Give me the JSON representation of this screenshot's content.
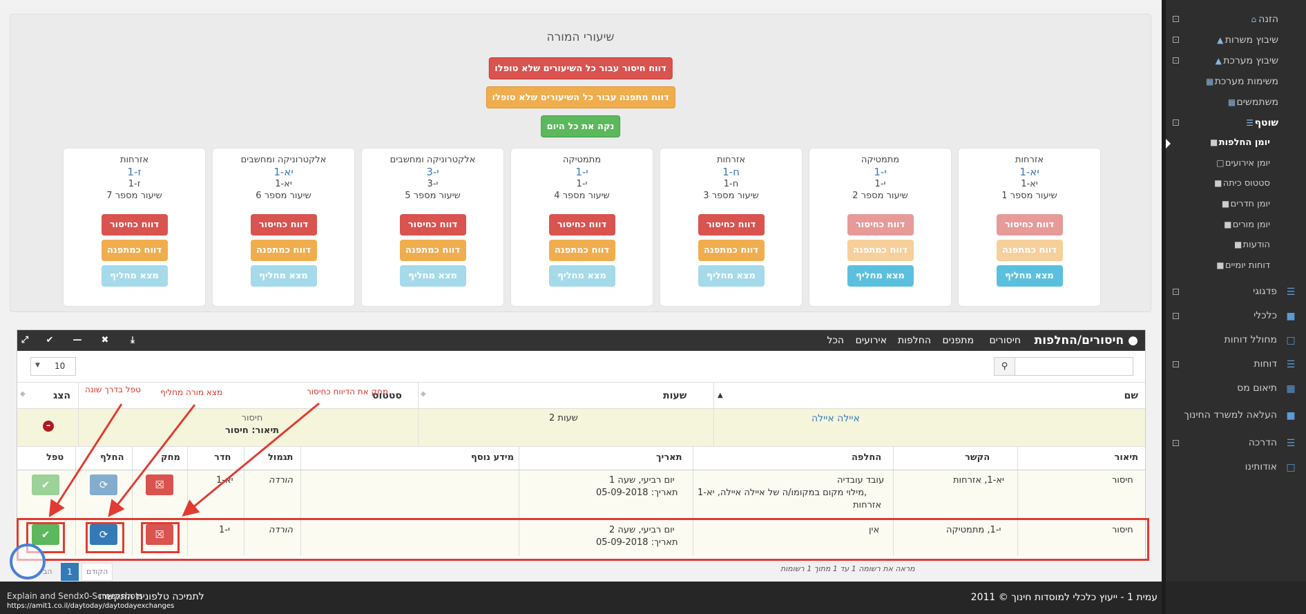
{
  "teacher_panel": {
    "title": "שיעורי המורה",
    "btn_missing_all": "דווח חיסור עבור כל השיעורים שלא טופלו",
    "btn_sub_all": "דווח מתפנה עבור כל השיעורים שלא טופלו",
    "btn_clean": "נקה את כל היום",
    "lessons": [
      {
        "subject": "אזרחות",
        "class": "יא-1",
        "room": "יא-1",
        "lesson": "שיעור מספר 1",
        "btn_missing": "דווח כחיסור",
        "btn_sub": "דווח כמתפנה",
        "btn_find": "מצא מחליף"
      },
      {
        "subject": "מתמטיקה",
        "class": "י-1",
        "room": "י-1",
        "lesson": "שיעור מספר 2",
        "btn_missing": "דווח כחיסור",
        "btn_sub": "דווח כמתפנה",
        "btn_find": "מצא מחליף"
      },
      {
        "subject": "אזרחות",
        "class": "ח-1",
        "room": "ח-1",
        "lesson": "שיעור מספר 3",
        "btn_missing": "דווח כחיסור",
        "btn_sub": "דווח כמתפנה",
        "btn_find": "מצא מחליף"
      },
      {
        "subject": "מתמטיקה",
        "class": "י-1",
        "room": "י-1",
        "lesson": "שיעור מספר 4",
        "btn_missing": "דווח כחיסור",
        "btn_sub": "דווח כמתפנה",
        "btn_find": "מצא מחליף"
      },
      {
        "subject": "אלקטרוניקה ומחשבים",
        "class": "י-3",
        "room": "י-3",
        "lesson": "שיעור מספר 5",
        "btn_missing": "דווח כחיסור",
        "btn_sub": "דווח כמתפנה",
        "btn_find": "מצא מחליף"
      },
      {
        "subject": "אלקטרוניקה ומחשבים",
        "class": "יא-1",
        "room": "יא-1",
        "lesson": "שיעור מספר 6",
        "btn_missing": "דווח כחיסור",
        "btn_sub": "דווח כמתפנה",
        "btn_find": "מצא מחליף"
      },
      {
        "subject": "אזרחות",
        "class": "ז-1",
        "room": "ז-1",
        "lesson": "שיעור מספר 7",
        "btn_missing": "דווח כחיסור",
        "btn_sub": "דווח כמתפנה",
        "btn_find": "מצא מחליף"
      }
    ]
  },
  "widget": {
    "title": "חיסורים/החלפות",
    "tabs": [
      "חיסורים",
      "מתפנים",
      "החלפות",
      "אירועים",
      "הכל"
    ],
    "page_size": "10",
    "columns": {
      "name": "שם",
      "hours": "שעות",
      "status": "סטטוס",
      "show": "הצג"
    },
    "summary": {
      "name": "איילה איילה",
      "hours": "2 שעות",
      "status_line1": "חיסור",
      "status_line2": "תיאור: חיסור"
    },
    "detail_columns": [
      "תיאור",
      "הקשר",
      "החלפה",
      "תאריך",
      "מידע נוסף",
      "תגמול",
      "חדר",
      "מחק",
      "החלף",
      "טפל"
    ],
    "rows": [
      {
        "desc": "חיסור",
        "context": "יא-1, אזרחות",
        "sub_line1": "עובד עובדיה",
        "sub_line2": "מילוי מקום במקומו/ה של איילה איילה, יא-1,",
        "sub_line3": "אזרחות",
        "date_line1": "יום רביעי, שעה 1",
        "date_line2": "תאריך: 05-09-2018",
        "reward": "הורדה",
        "room": "יא-1"
      },
      {
        "desc": "חיסור",
        "context": "י-1, מתמטיקה",
        "sub_line1": "אין",
        "date_line1": "יום רביעי, שעה 2",
        "date_line2": "תאריך: 05-09-2018",
        "reward": "הורדה",
        "room": "י-1"
      }
    ],
    "footer_info": "מראה את רשומה 1 עד 1 מתוך 1 רשומות",
    "pager_prev": "הקודם",
    "pager_current": "1",
    "pager_next": "הב"
  },
  "annotations": {
    "delete": "מחק את הדיווח כחיסור",
    "find": "מצא מורה מחליף",
    "handle": "טפל בדרך שונה"
  },
  "bottom": {
    "copyright": "עמית 1 - ייעוץ כלכלי למוסדות חינוך  © 2011",
    "support": "לתמיכה טלפונית התקשרו",
    "phone": "Explain and Sendx0-Screenshots",
    "status_url": "https://amit1.co.il/daytoday/daytodayexchanges"
  },
  "sidebar": {
    "items": [
      "הזנה",
      "שיבוץ משרות",
      "שיבוץ מערכת",
      "משימות מערכת",
      "משתמשים",
      "שוטף"
    ],
    "sub_items": [
      "יומן החלפות",
      "יומן אירועים",
      "סטטוס כיתה",
      "יומן חדרים",
      "יומן מורים",
      "הודעות",
      "דוחות יומיים"
    ],
    "lower_items": [
      "פדגוגי",
      "כלכלי",
      "מחולל דוחות",
      "דוחות",
      "תיאום מס",
      "העלאה למשרד החינוך",
      "הדרכה",
      "אודותינו"
    ]
  },
  "colors": {
    "danger": "#d9534f",
    "warning": "#f0ad4e",
    "success": "#5cb85c",
    "info": "#5bc0de",
    "primary": "#337ab7",
    "annotation": "#e03b32"
  }
}
